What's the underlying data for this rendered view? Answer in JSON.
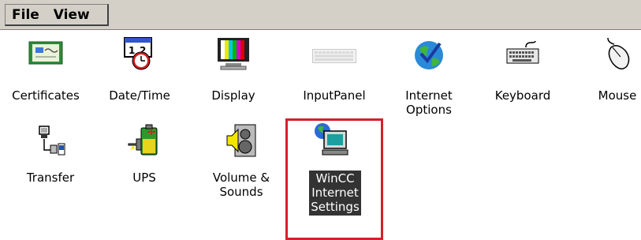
{
  "menu": {
    "file_label": "File",
    "view_label": "View"
  },
  "items": [
    {
      "label": "Certificates",
      "icon": "certificate-icon"
    },
    {
      "label": "Date/Time",
      "icon": "calendar-clock-icon"
    },
    {
      "label": "Display",
      "icon": "monitor-icon"
    },
    {
      "label": "InputPanel",
      "icon": "keyboard-panel-icon"
    },
    {
      "label": "Internet\nOptions",
      "icon": "globe-check-icon"
    },
    {
      "label": "Keyboard",
      "icon": "keyboard-icon"
    },
    {
      "label": "Mouse",
      "icon": "mouse-icon"
    },
    {
      "label": "Transfer",
      "icon": "network-transfer-icon"
    },
    {
      "label": "UPS",
      "icon": "battery-plug-icon"
    },
    {
      "label": "Volume &\nSounds",
      "icon": "speaker-icon"
    },
    {
      "label": "WinCC\nInternet\nSettings",
      "icon": "globe-computer-icon",
      "selected": true
    }
  ],
  "colors": {
    "selection_bg": "#333333",
    "highlight_border": "#d4202a",
    "menubar_bg": "#d4d0c8"
  }
}
